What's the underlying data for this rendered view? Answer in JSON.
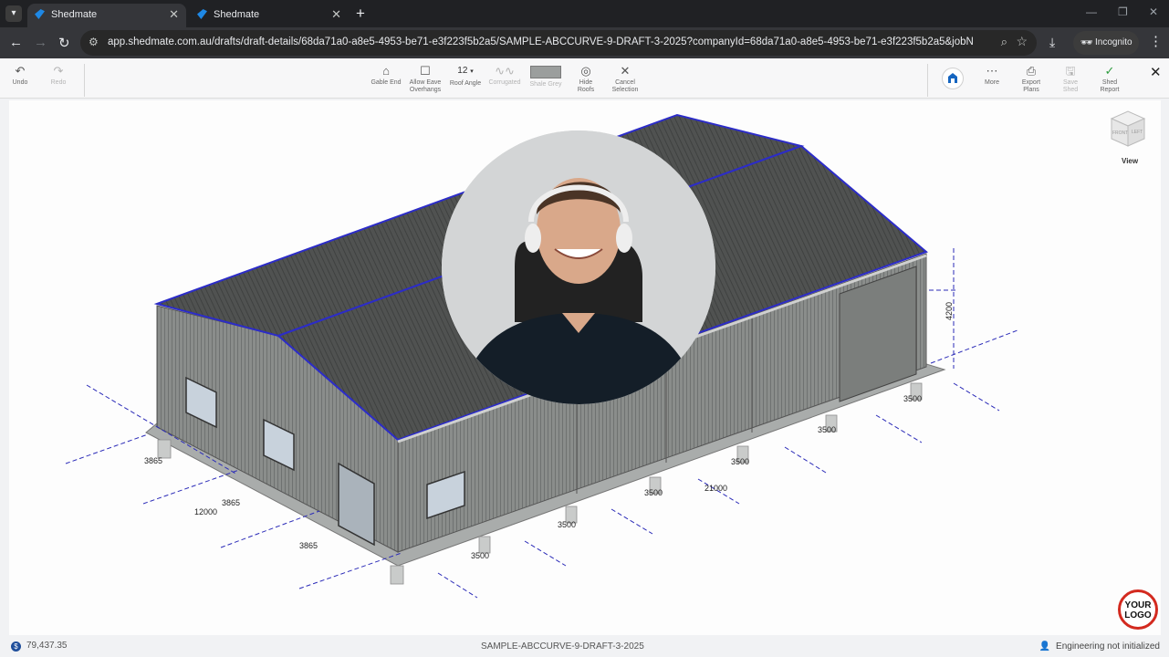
{
  "browser": {
    "tabs": [
      {
        "title": "Shedmate",
        "active": true
      },
      {
        "title": "Shedmate",
        "active": false
      }
    ],
    "url": "app.shedmate.com.au/drafts/draft-details/68da71a0-a8e5-4953-be71-e3f223f5b2a5/SAMPLE-ABCCURVE-9-DRAFT-3-2025?companyId=68da71a0-a8e5-4953-be71-e3f223f5b2a5&jobNumber=SAMPLE-AB...",
    "incognito_label": "Incognito"
  },
  "app_toolbar": {
    "undo": "Undo",
    "redo": "Redo",
    "gable_end": "Gable End",
    "allow_eave_line1": "Allow Eave",
    "allow_eave_line2": "Overhangs",
    "roof_angle_value": "12",
    "roof_angle": "Roof Angle",
    "corrugated": "Corrugated",
    "colour": "Shale Grey",
    "hide_roofs_line1": "Hide",
    "hide_roofs_line2": "Roofs",
    "cancel_line1": "Cancel",
    "cancel_line2": "Selection",
    "more": "More",
    "export_line1": "Export",
    "export_line2": "Plans",
    "save_line1": "Save",
    "save_line2": "Shed",
    "report_line1": "Shed",
    "report_line2": "Report"
  },
  "viewcube": {
    "front": "FRONT",
    "left": "LEFT",
    "top": "TOP",
    "label": "View"
  },
  "dimensions": {
    "height": "4200",
    "length_total": "21000",
    "width_total": "12000",
    "bay_front": [
      "3500",
      "3500",
      "3500"
    ],
    "bay_back": [
      "3500",
      "3500",
      "3500"
    ],
    "end_bays": [
      "3865",
      "3865",
      "3865"
    ]
  },
  "logo": {
    "line1": "YOUR",
    "line2": "LOGO"
  },
  "status": {
    "price": "79,437.35",
    "job": "SAMPLE-ABCCURVE-9-DRAFT-3-2025",
    "engineering": "Engineering not initialized"
  },
  "colors": {
    "brand_blue": "#1565c0",
    "roof": "#4f5150",
    "wall": "#8a8d8b",
    "edge_highlight": "#2c2cc8"
  }
}
